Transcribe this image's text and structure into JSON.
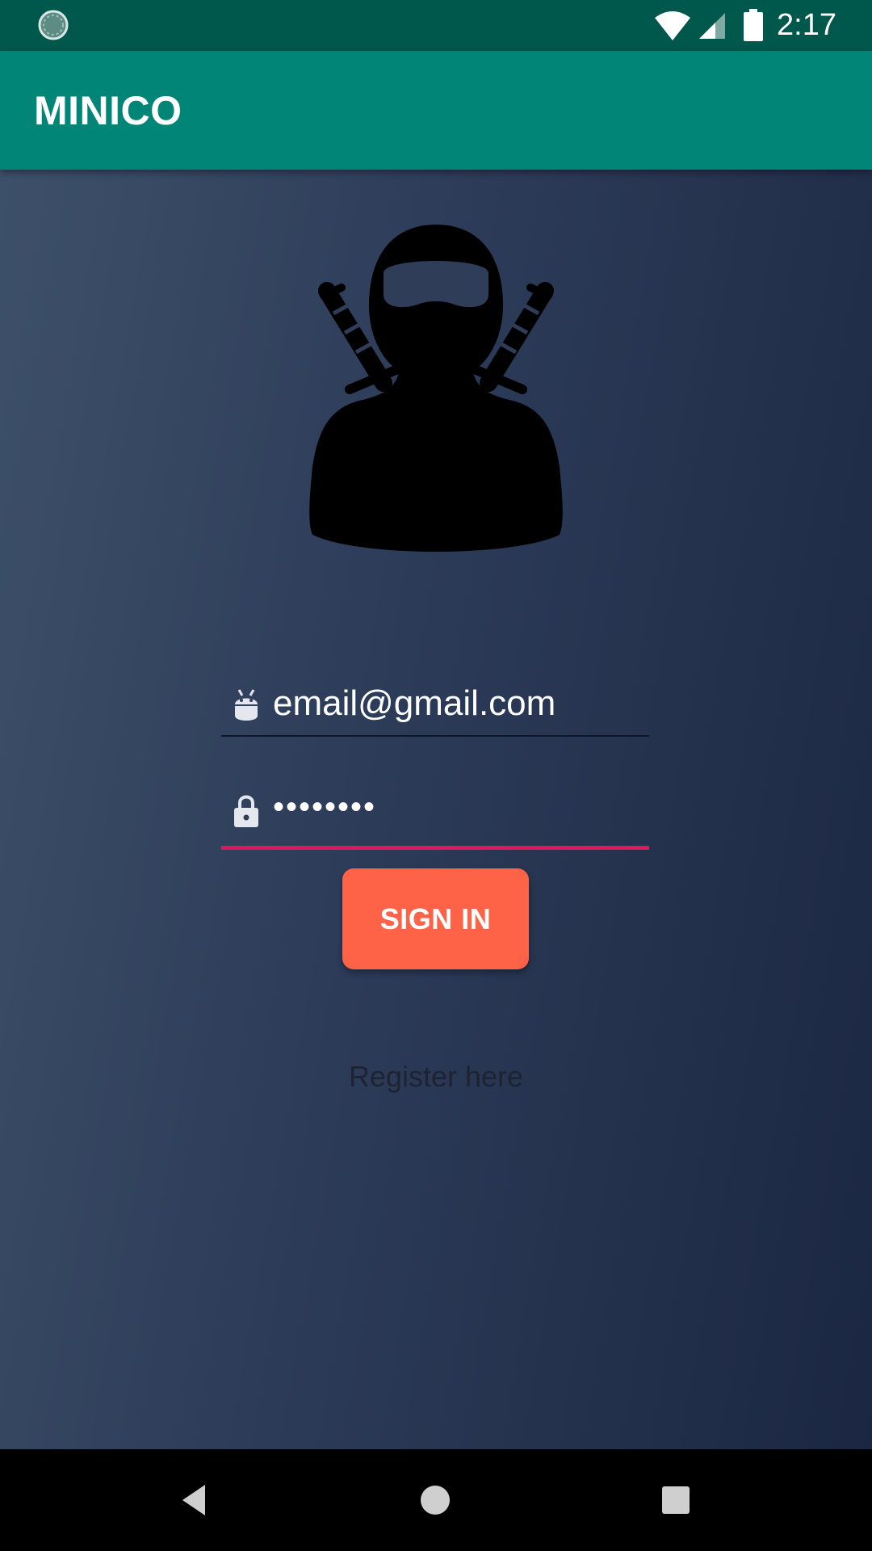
{
  "status_bar": {
    "time": "2:17",
    "icons": [
      "sync-icon",
      "wifi-icon",
      "signal-icon",
      "battery-icon"
    ]
  },
  "app_bar": {
    "title": "MINICO",
    "color": "#008577"
  },
  "login": {
    "logo": "ninja-avatar-icon",
    "email_value": "email@gmail.com",
    "email_icon": "android-icon",
    "password_masked": "••••••••",
    "password_icon": "lock-icon",
    "sign_in_label": "SIGN IN",
    "register_label": "Register here"
  },
  "colors": {
    "button": "#ff6347",
    "focus_underline": "#d81b60",
    "status_bar": "#00574b"
  },
  "nav_bar": {
    "buttons": [
      "back-button",
      "home-button",
      "recents-button"
    ]
  }
}
